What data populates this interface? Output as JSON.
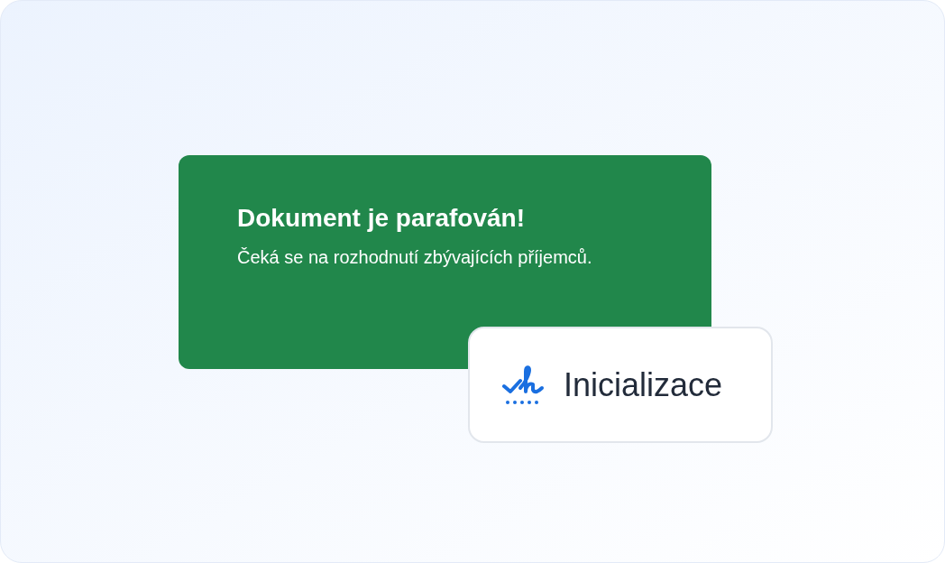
{
  "notification": {
    "title": "Dokument je parafován!",
    "message": "Čeká se na rozhodnutí zbývajících příjemců."
  },
  "chip": {
    "label": "Inicializace"
  }
}
